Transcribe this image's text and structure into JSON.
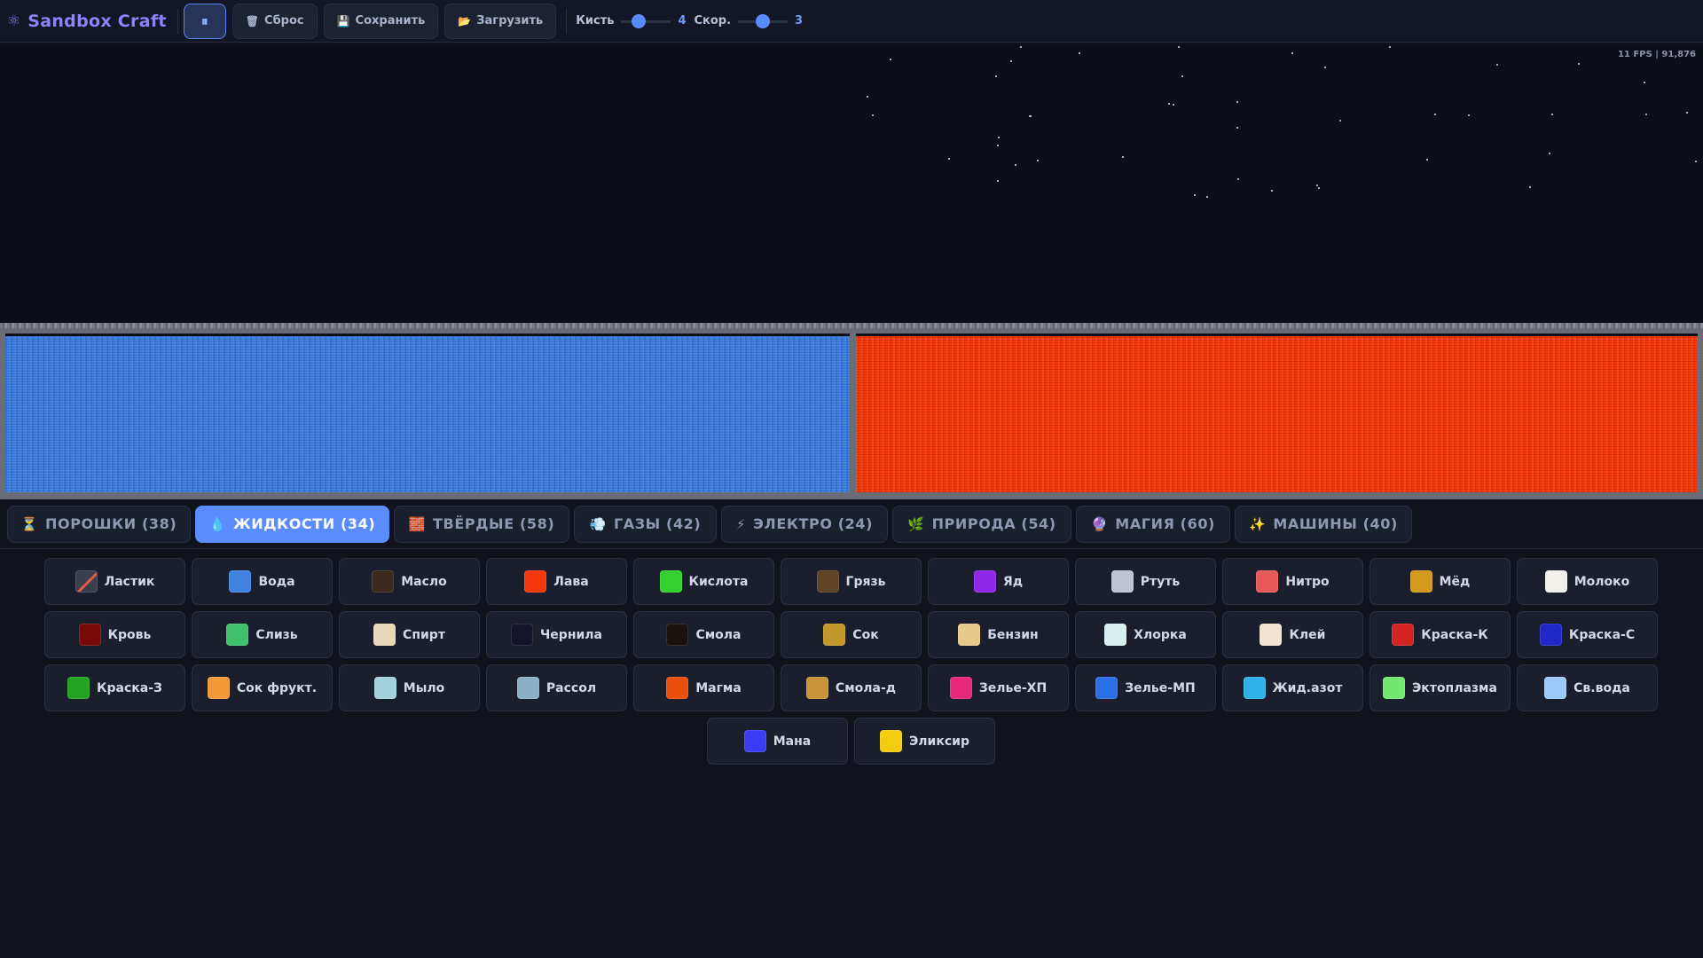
{
  "app": {
    "logo_icon": "⚛",
    "title": "Sandbox Craft",
    "brand_color": "#8f82ff"
  },
  "toolbar": {
    "pause_icon": "pause-icon",
    "pause_glyph": "⏸",
    "reset_icon": "🗑",
    "reset_label": "Сброс",
    "save_icon": "💾",
    "save_label": "Сохранить",
    "load_icon": "📂",
    "load_label": "Загрузить",
    "brush_label": "Кисть",
    "brush_value": 4,
    "brush_fraction": 0.3,
    "speed_label": "Скор.",
    "speed_value": 3,
    "speed_fraction": 0.5,
    "accent": "#5a8cff"
  },
  "canvas": {
    "fps_text": "11 FPS | 91,876",
    "water_color": "#3d7fe0",
    "lava_color": "#f23a0c"
  },
  "tabs": [
    {
      "icon": "⏳",
      "label": "ПОРОШКИ (38)",
      "active": false
    },
    {
      "icon": "💧",
      "label": "ЖИДКОСТИ (34)",
      "active": true
    },
    {
      "icon": "🧱",
      "label": "ТВЁРДЫЕ (58)",
      "active": false
    },
    {
      "icon": "💨",
      "label": "ГАЗЫ (42)",
      "active": false
    },
    {
      "icon": "⚡",
      "label": "ЭЛЕКТРО (24)",
      "active": false
    },
    {
      "icon": "🌿",
      "label": "ПРИРОДА (54)",
      "active": false
    },
    {
      "icon": "🔮",
      "label": "МАГИЯ (60)",
      "active": false
    },
    {
      "icon": "✨",
      "label": "МАШИНЫ (40)",
      "active": false
    }
  ],
  "elements": [
    {
      "label": "Ластик",
      "color": "eraser"
    },
    {
      "label": "Вода",
      "color": "#3f82e0"
    },
    {
      "label": "Масло",
      "color": "#3a2a20"
    },
    {
      "label": "Лава",
      "color": "#f2380c"
    },
    {
      "label": "Кислота",
      "color": "#33d12f"
    },
    {
      "label": "Грязь",
      "color": "#5e4424"
    },
    {
      "label": "Яд",
      "color": "#8d28e6"
    },
    {
      "label": "Ртуть",
      "color": "#bfc4d2"
    },
    {
      "label": "Нитро",
      "color": "#e85a5a"
    },
    {
      "label": "Мёд",
      "color": "#d49a1c"
    },
    {
      "label": "Молоко",
      "color": "#f2f0ea"
    },
    {
      "label": "Кровь",
      "color": "#7a0a0a"
    },
    {
      "label": "Слизь",
      "color": "#3fc06a"
    },
    {
      "label": "Спирт",
      "color": "#e8d7b8"
    },
    {
      "label": "Чернила",
      "color": "#15142a"
    },
    {
      "label": "Смола",
      "color": "#1a120c"
    },
    {
      "label": "Сок",
      "color": "#c2962a"
    },
    {
      "label": "Бензин",
      "color": "#e8c98a"
    },
    {
      "label": "Хлорка",
      "color": "#d8f0ee"
    },
    {
      "label": "Клей",
      "color": "#eee4d0"
    },
    {
      "label": "Краска-К",
      "color": "#d22424"
    },
    {
      "label": "Краска-С",
      "color": "#2228c8"
    },
    {
      "label": "Краска-З",
      "color": "#22a322"
    },
    {
      "label": "Сок фрукт.",
      "color": "#f29a3a"
    },
    {
      "label": "Мыло",
      "color": "#a4d2dc"
    },
    {
      "label": "Рассол",
      "color": "#8ab0c4"
    },
    {
      "label": "Магма",
      "color": "#e8500c"
    },
    {
      "label": "Смола-д",
      "color": "#c8943a"
    },
    {
      "label": "Зелье-ХП",
      "color": "#e8287a"
    },
    {
      "label": "Зелье-МП",
      "color": "#2a6ee8"
    },
    {
      "label": "Жид.азот",
      "color": "#30b2e8"
    },
    {
      "label": "Эктоплазма",
      "color": "#72e86e"
    },
    {
      "label": "Св.вода",
      "color": "#9ccaf8"
    }
  ],
  "last_row": [
    {
      "label": "Мана",
      "color": "#3a3cf0"
    },
    {
      "label": "Эликсир",
      "color": "#f2cc10"
    }
  ]
}
